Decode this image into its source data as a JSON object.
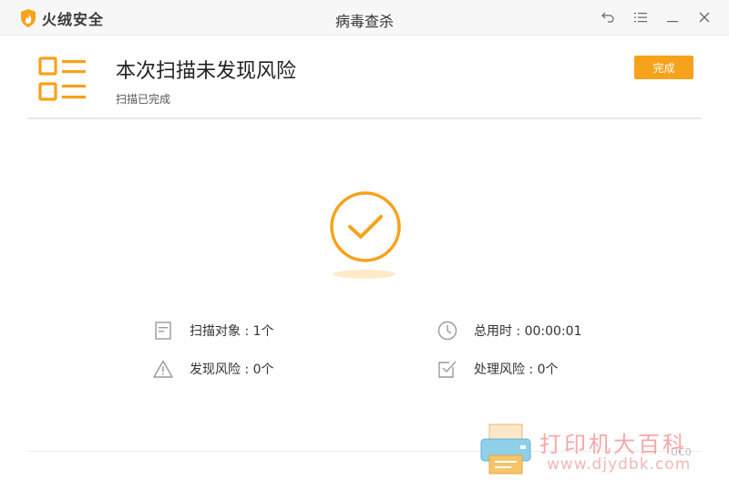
{
  "app": {
    "brand": "火绒安全",
    "window_title": "病毒查杀",
    "brand_color": "#f7a21b"
  },
  "window_controls": {
    "icons": [
      "undo-icon",
      "menu-icon",
      "minimize-icon",
      "close-icon"
    ]
  },
  "header": {
    "title": "本次扫描未发现风险",
    "subtitle": "扫描已完成",
    "done_label": "完成"
  },
  "stats": {
    "scan_objects": "扫描对象 : 1个",
    "total_time": "总用时 : 00:00:01",
    "risks_found": "发现风险 : 0个",
    "risks_handled": "处理风险 : 0个"
  },
  "watermark": {
    "text": "打印机大百科",
    "url": "www.djydbk.com",
    "faint": "UC0"
  }
}
